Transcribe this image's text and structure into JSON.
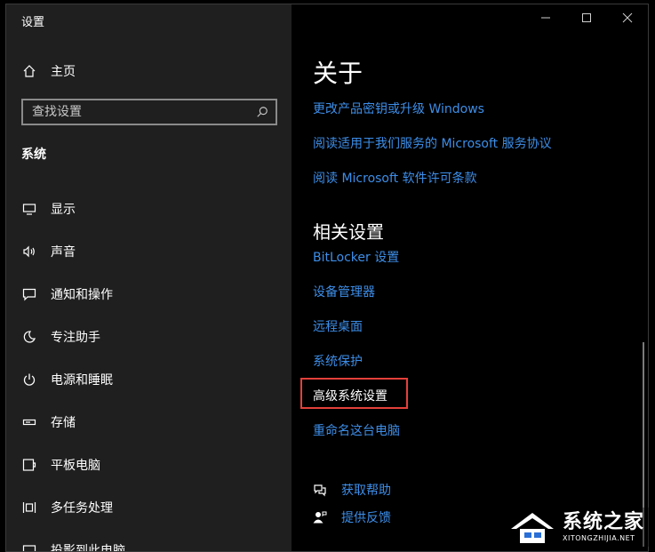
{
  "window": {
    "title": "设置"
  },
  "sidebar": {
    "home_label": "主页",
    "search_placeholder": "查找设置",
    "section_title": "系统",
    "items": [
      {
        "label": "显示",
        "icon": "monitor-icon"
      },
      {
        "label": "声音",
        "icon": "speaker-icon"
      },
      {
        "label": "通知和操作",
        "icon": "notification-icon"
      },
      {
        "label": "专注助手",
        "icon": "moon-icon"
      },
      {
        "label": "电源和睡眠",
        "icon": "power-icon"
      },
      {
        "label": "存储",
        "icon": "storage-icon"
      },
      {
        "label": "平板电脑",
        "icon": "tablet-icon"
      },
      {
        "label": "多任务处理",
        "icon": "multitask-icon"
      },
      {
        "label": "投影到此电脑",
        "icon": "projector-icon"
      }
    ]
  },
  "main": {
    "page_title": "关于",
    "top_links": [
      "更改产品密钥或升级 Windows",
      "阅读适用于我们服务的 Microsoft 服务协议",
      "阅读 Microsoft 软件许可条款"
    ],
    "related_title": "相关设置",
    "related_links": [
      "BitLocker 设置",
      "设备管理器",
      "远程桌面",
      "系统保护",
      "高级系统设置",
      "重命名这台电脑"
    ],
    "help_links": [
      {
        "label": "获取帮助",
        "icon": "help-chat-icon"
      },
      {
        "label": "提供反馈",
        "icon": "feedback-icon"
      }
    ]
  },
  "watermark": {
    "main": "系统之家",
    "sub": "XITONGZHIJIA.NET"
  },
  "colors": {
    "sidebar_bg": "#1f1f1f",
    "content_bg": "#000000",
    "link": "#3d8ee8",
    "highlight_border": "#e4403b"
  }
}
